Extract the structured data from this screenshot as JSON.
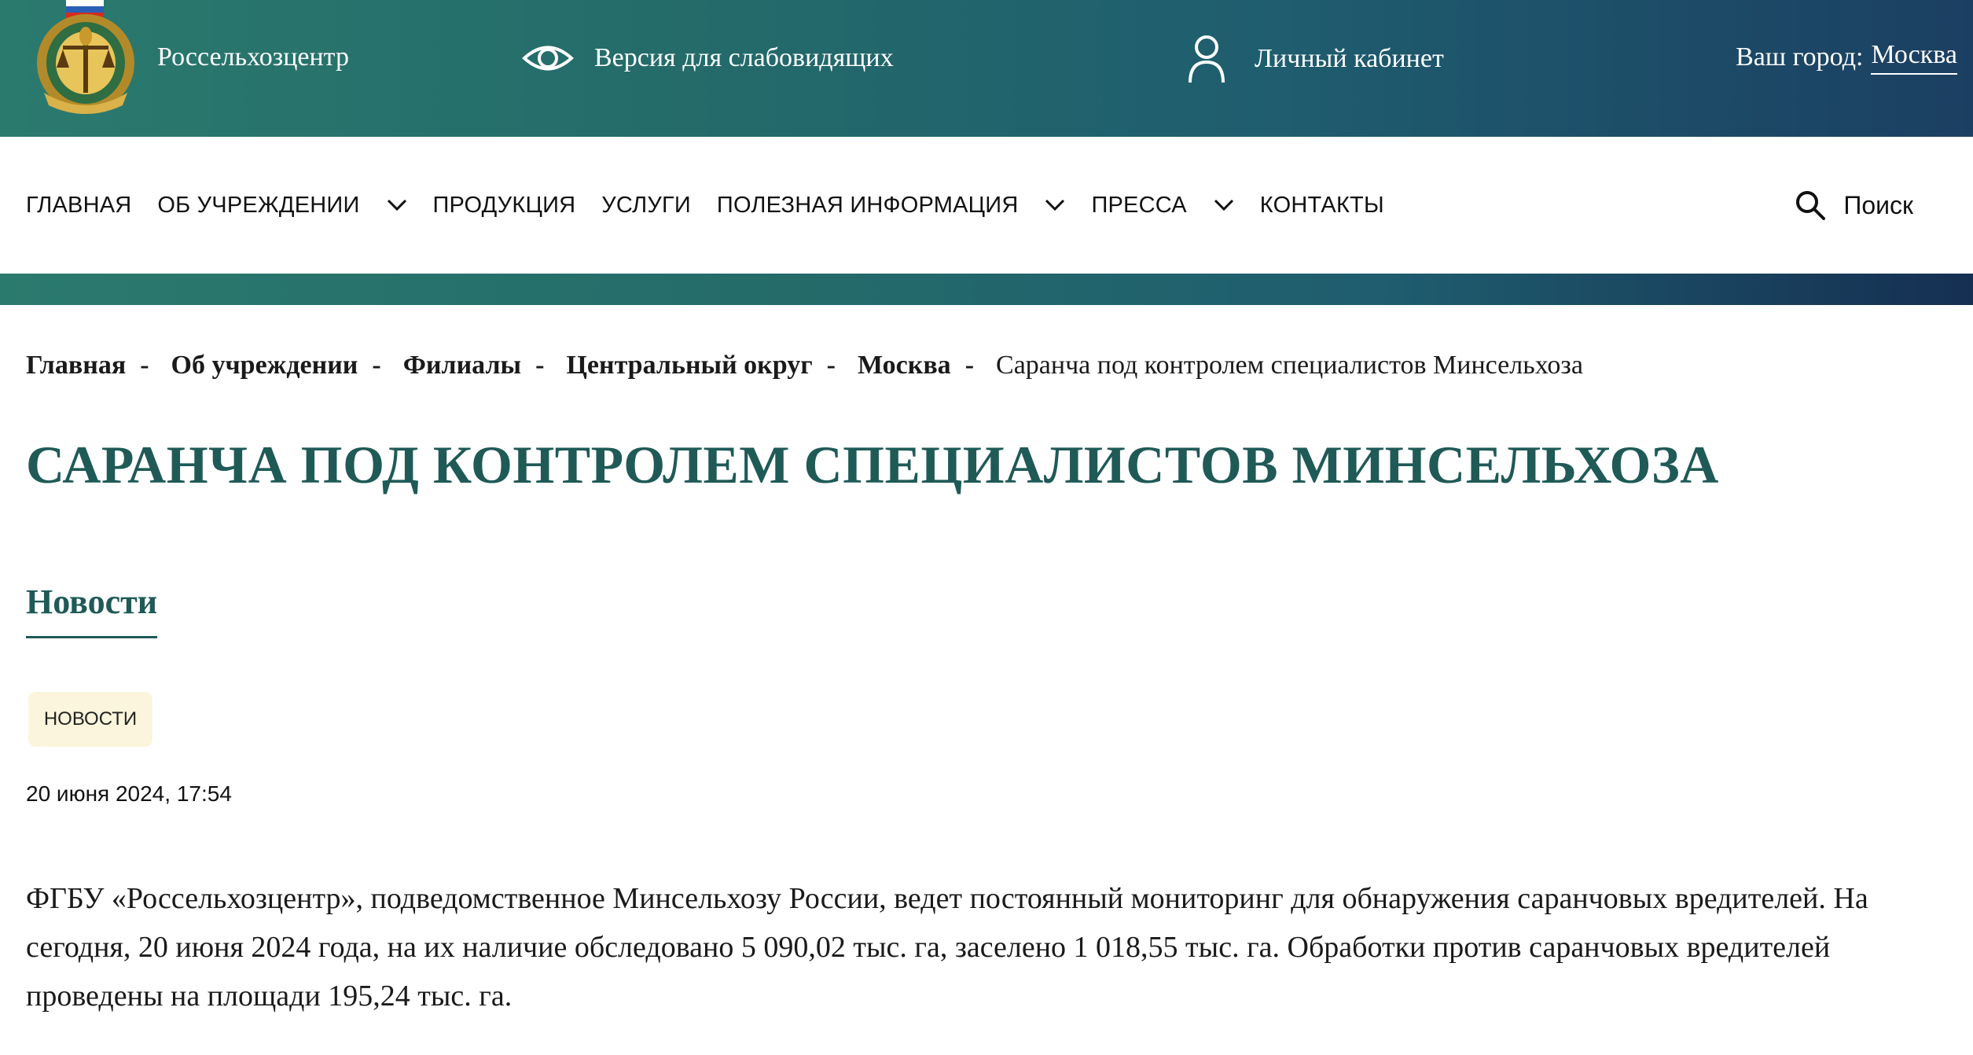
{
  "header": {
    "brand": "Россельхозцентр",
    "accessibility_label": "Версия для слабовидящих",
    "cabinet_label": "Личный кабинет",
    "city_label": "Ваш город:",
    "city_value": "Москва"
  },
  "nav": {
    "items": [
      {
        "label": "ГЛАВНАЯ",
        "has_dropdown": false
      },
      {
        "label": "ОБ УЧРЕЖДЕНИИ",
        "has_dropdown": true
      },
      {
        "label": "ПРОДУКЦИЯ",
        "has_dropdown": false
      },
      {
        "label": "УСЛУГИ",
        "has_dropdown": false
      },
      {
        "label": "ПОЛЕЗНАЯ ИНФОРМАЦИЯ",
        "has_dropdown": true
      },
      {
        "label": "ПРЕССА",
        "has_dropdown": true
      },
      {
        "label": "КОНТАКТЫ",
        "has_dropdown": false
      }
    ],
    "search_label": "Поиск"
  },
  "breadcrumb": {
    "items": [
      "Главная",
      "Об учреждении",
      "Филиалы",
      "Центральный округ",
      "Москва"
    ],
    "separator": "-",
    "current": "Саранча под контролем специалистов Минсельхоза"
  },
  "page": {
    "title": "САРАНЧА ПОД КОНТРОЛЕМ СПЕЦИАЛИСТОВ МИНСЕЛЬХОЗА",
    "section_tab": "Новости",
    "tag": "НОВОСТИ",
    "date": "20 июня 2024, 17:54",
    "body": "ФГБУ «Россельхозцентр», подведомственное Минсельхозу России, ведет постоянный мониторинг для обнаружения саранчовых вредителей. На сегодня, 20 июня 2024 года, на их наличие обследовано 5 090,02 тыс. га, заселено 1 018,55 тыс. га. Обработки против саранчовых вредителей проведены на площади 195,24 тыс. га."
  },
  "colors": {
    "header_gradient_start": "#2b7a6e",
    "header_gradient_end": "#1b3f62",
    "title_color": "#1f5a57",
    "tag_background": "#faf5dc"
  },
  "icons": {
    "logo": "coat-of-arms-logo",
    "accessibility": "eye-icon",
    "cabinet": "user-icon",
    "search": "search-icon",
    "dropdown": "chevron-down-icon"
  }
}
